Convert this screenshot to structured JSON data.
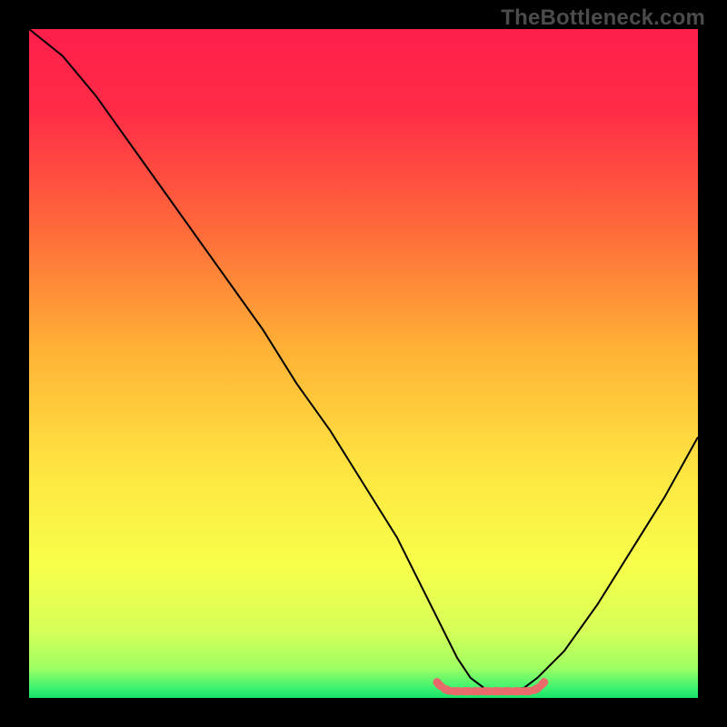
{
  "watermark": "TheBottleneck.com",
  "colors": {
    "gradient_stops": [
      {
        "offset": 0.0,
        "color": "#ff1f4b"
      },
      {
        "offset": 0.12,
        "color": "#ff2b47"
      },
      {
        "offset": 0.3,
        "color": "#ff6a3a"
      },
      {
        "offset": 0.48,
        "color": "#ffb236"
      },
      {
        "offset": 0.65,
        "color": "#ffe341"
      },
      {
        "offset": 0.8,
        "color": "#f8ff4a"
      },
      {
        "offset": 0.9,
        "color": "#d6ff58"
      },
      {
        "offset": 0.955,
        "color": "#9fff63"
      },
      {
        "offset": 0.985,
        "color": "#3ef26f"
      },
      {
        "offset": 1.0,
        "color": "#17e36a"
      }
    ],
    "marker": "#e96a6a",
    "curve": "#000000",
    "frame": "#000000"
  },
  "chart_data": {
    "type": "line",
    "title": "",
    "xlabel": "",
    "ylabel": "",
    "xlim": [
      0,
      100
    ],
    "ylim": [
      0,
      100
    ],
    "x": [
      0,
      5,
      10,
      15,
      20,
      25,
      30,
      35,
      40,
      45,
      50,
      55,
      60,
      62,
      64,
      66,
      68,
      70,
      72,
      74,
      76,
      80,
      85,
      90,
      95,
      100
    ],
    "values": [
      100,
      96,
      90,
      83,
      76,
      69,
      62,
      55,
      47,
      40,
      32,
      24,
      14,
      10,
      6,
      3,
      1.5,
      1,
      1,
      1.5,
      3,
      7,
      14,
      22,
      30,
      39
    ],
    "marker_region": {
      "x_start": 61,
      "x_end": 77,
      "y": 1
    },
    "annotations": []
  }
}
